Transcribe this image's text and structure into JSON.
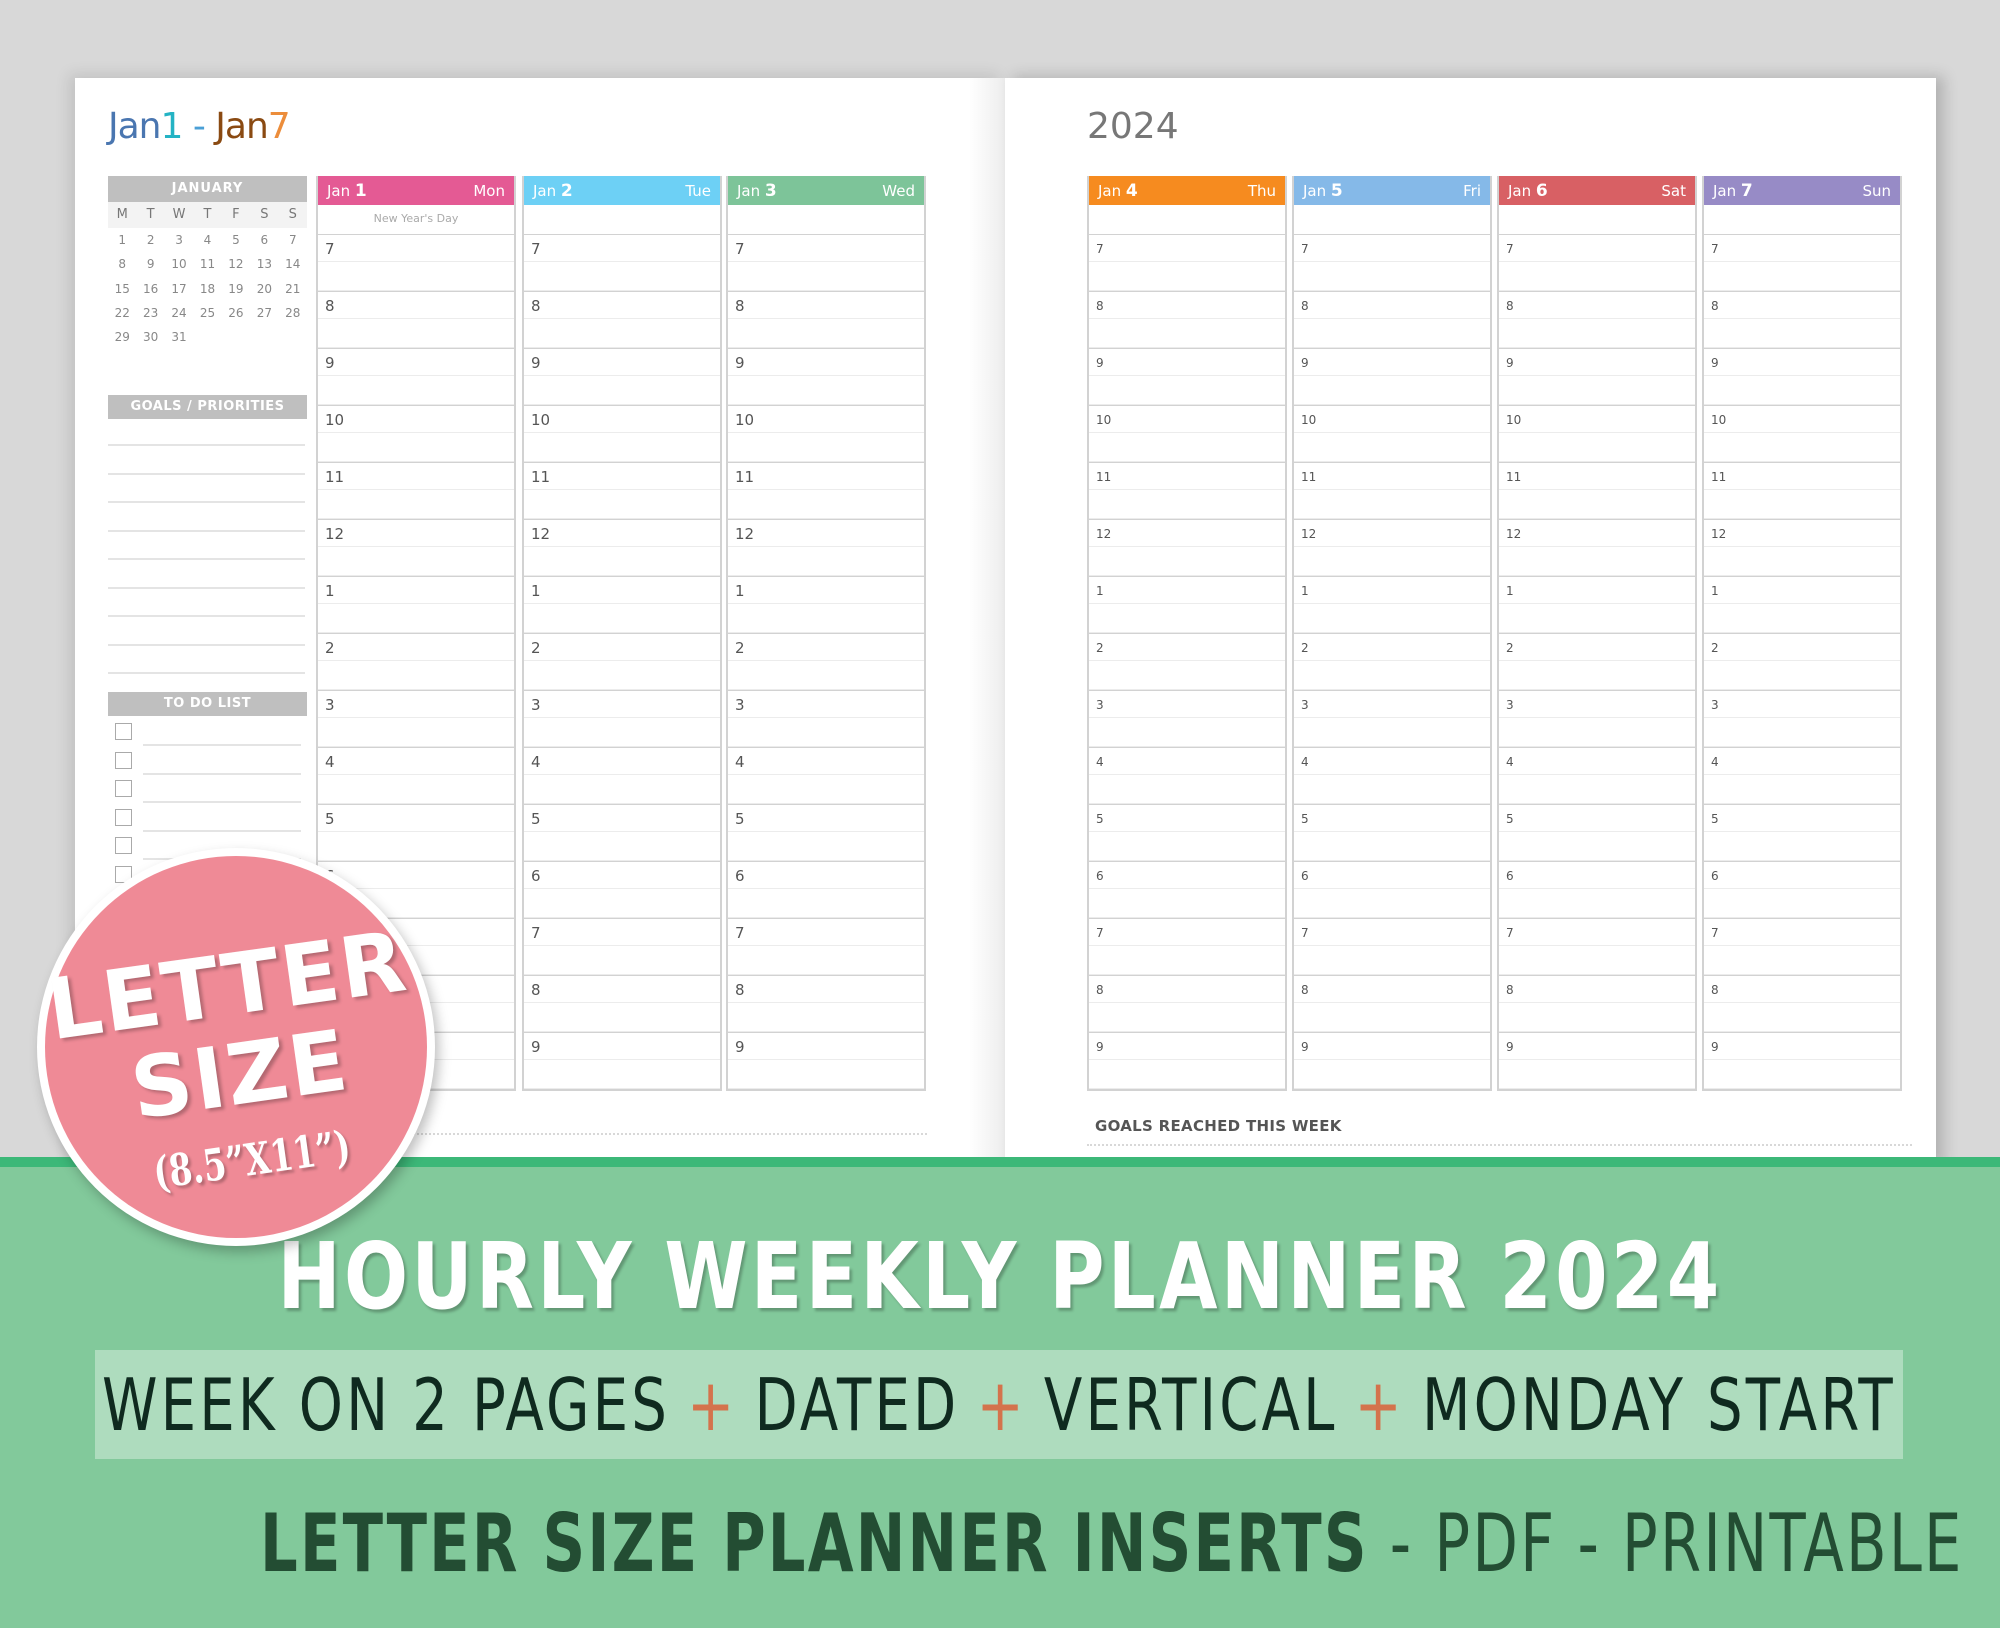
{
  "left_page": {
    "week_title": {
      "part1": "Jan",
      "part2": "1",
      "sep": " - ",
      "part3": "Jan",
      "part4": "7"
    },
    "mini_calendar": {
      "month": "JANUARY",
      "weekdays": [
        "M",
        "T",
        "W",
        "T",
        "F",
        "S",
        "S"
      ],
      "dates": [
        "1",
        "2",
        "3",
        "4",
        "5",
        "6",
        "7",
        "8",
        "9",
        "10",
        "11",
        "12",
        "13",
        "14",
        "15",
        "16",
        "17",
        "18",
        "19",
        "20",
        "21",
        "22",
        "23",
        "24",
        "25",
        "26",
        "27",
        "28",
        "29",
        "30",
        "31"
      ]
    },
    "goals_header": "GOALS / PRIORITIES",
    "todo_header": "TO DO LIST",
    "days": [
      {
        "month": "Jan",
        "day": "1",
        "weekday": "Mon",
        "color": "#e45a94",
        "note": "New Year's Day"
      },
      {
        "month": "Jan",
        "day": "2",
        "weekday": "Tue",
        "color": "#6dd0f5",
        "note": ""
      },
      {
        "month": "Jan",
        "day": "3",
        "weekday": "Wed",
        "color": "#7dc499",
        "note": ""
      }
    ]
  },
  "right_page": {
    "year_title": "2024",
    "days": [
      {
        "month": "Jan",
        "day": "4",
        "weekday": "Thu",
        "color": "#f68b1f",
        "note": ""
      },
      {
        "month": "Jan",
        "day": "5",
        "weekday": "Fri",
        "color": "#85b9e8",
        "note": ""
      },
      {
        "month": "Jan",
        "day": "6",
        "weekday": "Sat",
        "color": "#d86064",
        "note": ""
      },
      {
        "month": "Jan",
        "day": "7",
        "weekday": "Sun",
        "color": "#978bc6",
        "note": ""
      }
    ],
    "goals_reached": "GOALS REACHED THIS WEEK"
  },
  "hours": [
    "7",
    "8",
    "9",
    "10",
    "11",
    "12",
    "1",
    "2",
    "3",
    "4",
    "5",
    "6",
    "7",
    "8",
    "9"
  ],
  "badge": {
    "line1": "LETTER",
    "line2": "SIZE",
    "line3": "(8.5”X11”)",
    "color": "#ef8a96"
  },
  "banner": {
    "title": "HOURLY WEEKLY PLANNER 2024",
    "features": [
      "WEEK ON 2 PAGES",
      "DATED",
      "VERTICAL",
      "MONDAY START"
    ],
    "feature_separator": "+",
    "subtitle_strong": "LETTER SIZE PLANNER INSERTS",
    "subtitle_rest": " - PDF - PRINTABLE",
    "bg_color": "#82c99b",
    "stripe_color": "#3cb878"
  }
}
